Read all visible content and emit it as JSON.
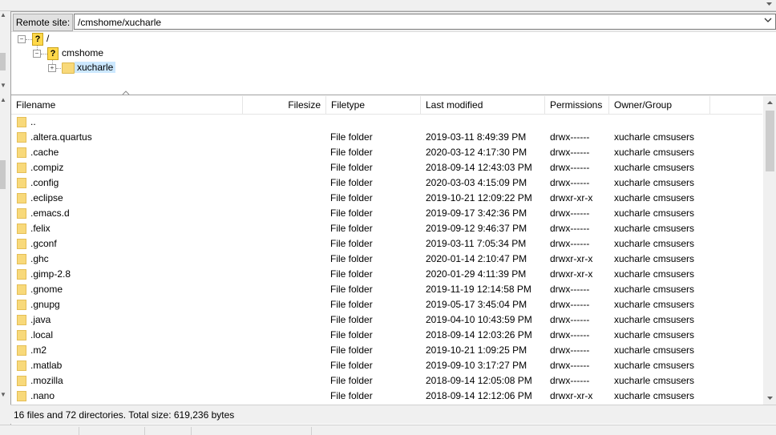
{
  "site_bar": {
    "label": "Remote site:",
    "path": "/cmshome/xucharle"
  },
  "tree": [
    {
      "label": "/",
      "icon": "question-icon",
      "expander": "−"
    },
    {
      "label": "cmshome",
      "icon": "question-icon",
      "expander": "−"
    },
    {
      "label": "xucharle",
      "icon": "folder-icon",
      "expander": "+",
      "selected": true
    }
  ],
  "columns": {
    "filename": "Filename",
    "filesize": "Filesize",
    "filetype": "Filetype",
    "last_modified": "Last modified",
    "permissions": "Permissions",
    "owner_group": "Owner/Group"
  },
  "files": [
    {
      "name": "..",
      "size": "",
      "type": "",
      "modified": "",
      "perms": "",
      "owner": ""
    },
    {
      "name": ".altera.quartus",
      "size": "",
      "type": "File folder",
      "modified": "2019-03-11 8:49:39 PM",
      "perms": "drwx------",
      "owner": "xucharle cmsusers"
    },
    {
      "name": ".cache",
      "size": "",
      "type": "File folder",
      "modified": "2020-03-12 4:17:30 PM",
      "perms": "drwx------",
      "owner": "xucharle cmsusers"
    },
    {
      "name": ".compiz",
      "size": "",
      "type": "File folder",
      "modified": "2018-09-14 12:43:03 PM",
      "perms": "drwx------",
      "owner": "xucharle cmsusers"
    },
    {
      "name": ".config",
      "size": "",
      "type": "File folder",
      "modified": "2020-03-03 4:15:09 PM",
      "perms": "drwx------",
      "owner": "xucharle cmsusers"
    },
    {
      "name": ".eclipse",
      "size": "",
      "type": "File folder",
      "modified": "2019-10-21 12:09:22 PM",
      "perms": "drwxr-xr-x",
      "owner": "xucharle cmsusers"
    },
    {
      "name": ".emacs.d",
      "size": "",
      "type": "File folder",
      "modified": "2019-09-17 3:42:36 PM",
      "perms": "drwx------",
      "owner": "xucharle cmsusers"
    },
    {
      "name": ".felix",
      "size": "",
      "type": "File folder",
      "modified": "2019-09-12 9:46:37 PM",
      "perms": "drwx------",
      "owner": "xucharle cmsusers"
    },
    {
      "name": ".gconf",
      "size": "",
      "type": "File folder",
      "modified": "2019-03-11 7:05:34 PM",
      "perms": "drwx------",
      "owner": "xucharle cmsusers"
    },
    {
      "name": ".ghc",
      "size": "",
      "type": "File folder",
      "modified": "2020-01-14 2:10:47 PM",
      "perms": "drwxr-xr-x",
      "owner": "xucharle cmsusers"
    },
    {
      "name": ".gimp-2.8",
      "size": "",
      "type": "File folder",
      "modified": "2020-01-29 4:11:39 PM",
      "perms": "drwxr-xr-x",
      "owner": "xucharle cmsusers"
    },
    {
      "name": ".gnome",
      "size": "",
      "type": "File folder",
      "modified": "2019-11-19 12:14:58 PM",
      "perms": "drwx------",
      "owner": "xucharle cmsusers"
    },
    {
      "name": ".gnupg",
      "size": "",
      "type": "File folder",
      "modified": "2019-05-17 3:45:04 PM",
      "perms": "drwx------",
      "owner": "xucharle cmsusers"
    },
    {
      "name": ".java",
      "size": "",
      "type": "File folder",
      "modified": "2019-04-10 10:43:59 PM",
      "perms": "drwx------",
      "owner": "xucharle cmsusers"
    },
    {
      "name": ".local",
      "size": "",
      "type": "File folder",
      "modified": "2018-09-14 12:03:26 PM",
      "perms": "drwx------",
      "owner": "xucharle cmsusers"
    },
    {
      "name": ".m2",
      "size": "",
      "type": "File folder",
      "modified": "2019-10-21 1:09:25 PM",
      "perms": "drwx------",
      "owner": "xucharle cmsusers"
    },
    {
      "name": ".matlab",
      "size": "",
      "type": "File folder",
      "modified": "2019-09-10 3:17:27 PM",
      "perms": "drwx------",
      "owner": "xucharle cmsusers"
    },
    {
      "name": ".mozilla",
      "size": "",
      "type": "File folder",
      "modified": "2018-09-14 12:05:08 PM",
      "perms": "drwx------",
      "owner": "xucharle cmsusers"
    },
    {
      "name": ".nano",
      "size": "",
      "type": "File folder",
      "modified": "2018-09-14 12:12:06 PM",
      "perms": "drwxr-xr-x",
      "owner": "xucharle cmsusers"
    }
  ],
  "status": {
    "text": "16 files and 72 directories. Total size: 619,236 bytes"
  },
  "icons": {
    "folder": "folder-icon",
    "unknown": "question-icon",
    "dropdown": "chevron-down-icon",
    "sort": "sort-ascending-icon"
  },
  "colors": {
    "folder_fill": "#f8d97a",
    "selection": "#cce8ff",
    "question_fill": "#ffd84a"
  }
}
